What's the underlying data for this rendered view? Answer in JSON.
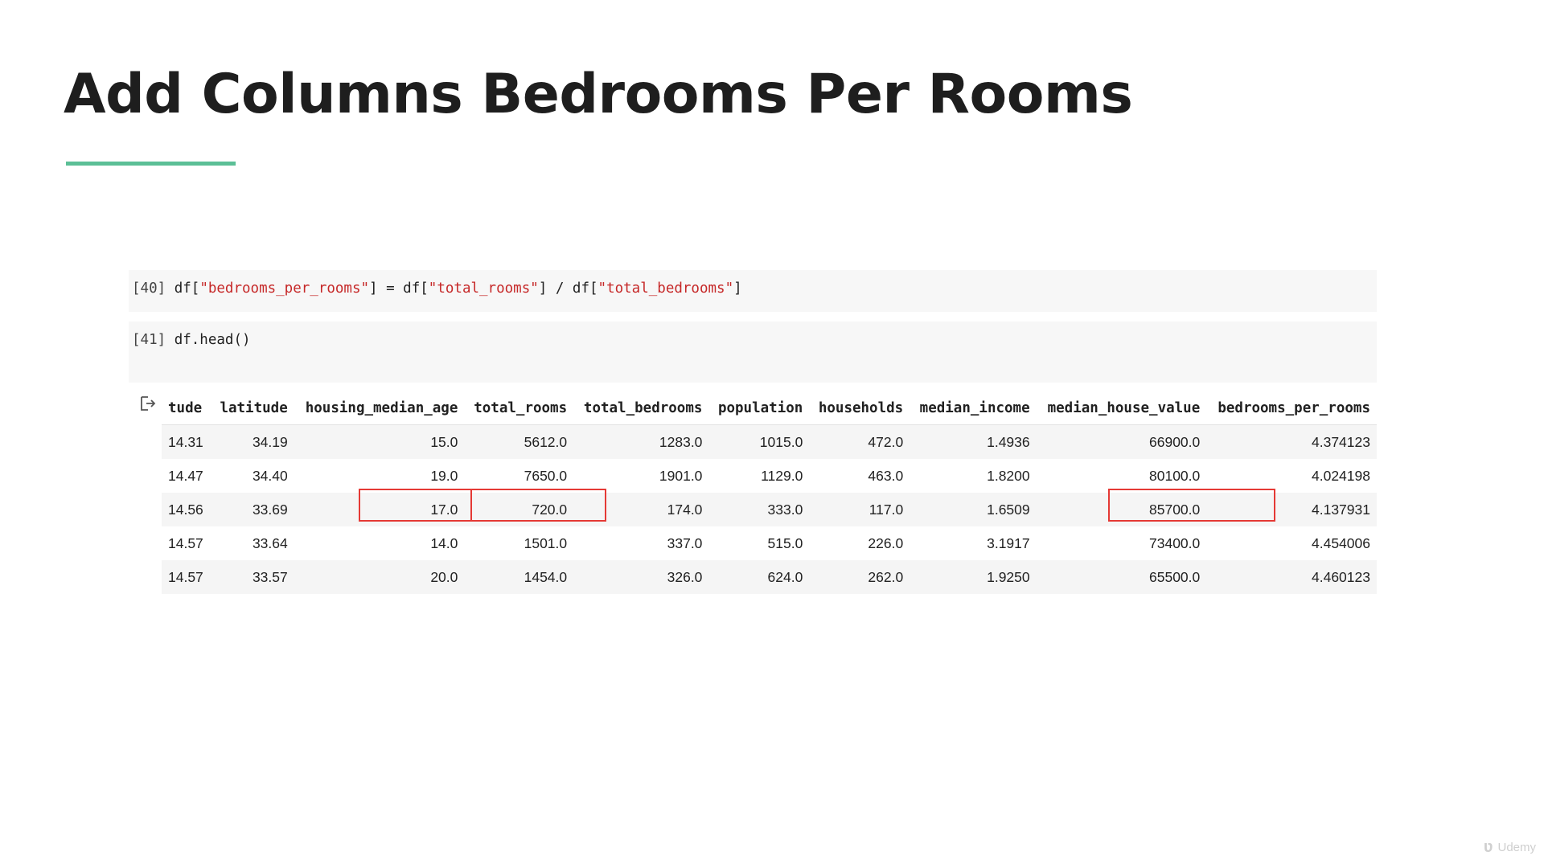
{
  "slide": {
    "title": "Add Columns Bedrooms Per Rooms",
    "accent_color": "#5bbf96",
    "watermark": "Udemy"
  },
  "cells": [
    {
      "prompt": "[40]",
      "code_parts": [
        "df[",
        "\"bedrooms_per_rooms\"",
        "] = df[",
        "\"total_rooms\"",
        "] / df[",
        "\"total_bedrooms\"",
        "]"
      ]
    },
    {
      "prompt": "[41]",
      "code": "df.head()"
    }
  ],
  "output": {
    "icon": "output-redirect-icon",
    "columns": [
      "tude",
      "latitude",
      "housing_median_age",
      "total_rooms",
      "total_bedrooms",
      "population",
      "households",
      "median_income",
      "median_house_value",
      "bedrooms_per_rooms"
    ],
    "rows": [
      [
        "14.31",
        "34.19",
        "15.0",
        "5612.0",
        "1283.0",
        "1015.0",
        "472.0",
        "1.4936",
        "66900.0",
        "4.374123"
      ],
      [
        "14.47",
        "34.40",
        "19.0",
        "7650.0",
        "1901.0",
        "1129.0",
        "463.0",
        "1.8200",
        "80100.0",
        "4.024198"
      ],
      [
        "14.56",
        "33.69",
        "17.0",
        "720.0",
        "174.0",
        "333.0",
        "117.0",
        "1.6509",
        "85700.0",
        "4.137931"
      ],
      [
        "14.57",
        "33.64",
        "14.0",
        "1501.0",
        "337.0",
        "515.0",
        "226.0",
        "3.1917",
        "73400.0",
        "4.454006"
      ],
      [
        "14.57",
        "33.57",
        "20.0",
        "1454.0",
        "326.0",
        "624.0",
        "262.0",
        "1.9250",
        "65500.0",
        "4.460123"
      ]
    ],
    "highlight_color": "#e53935"
  }
}
